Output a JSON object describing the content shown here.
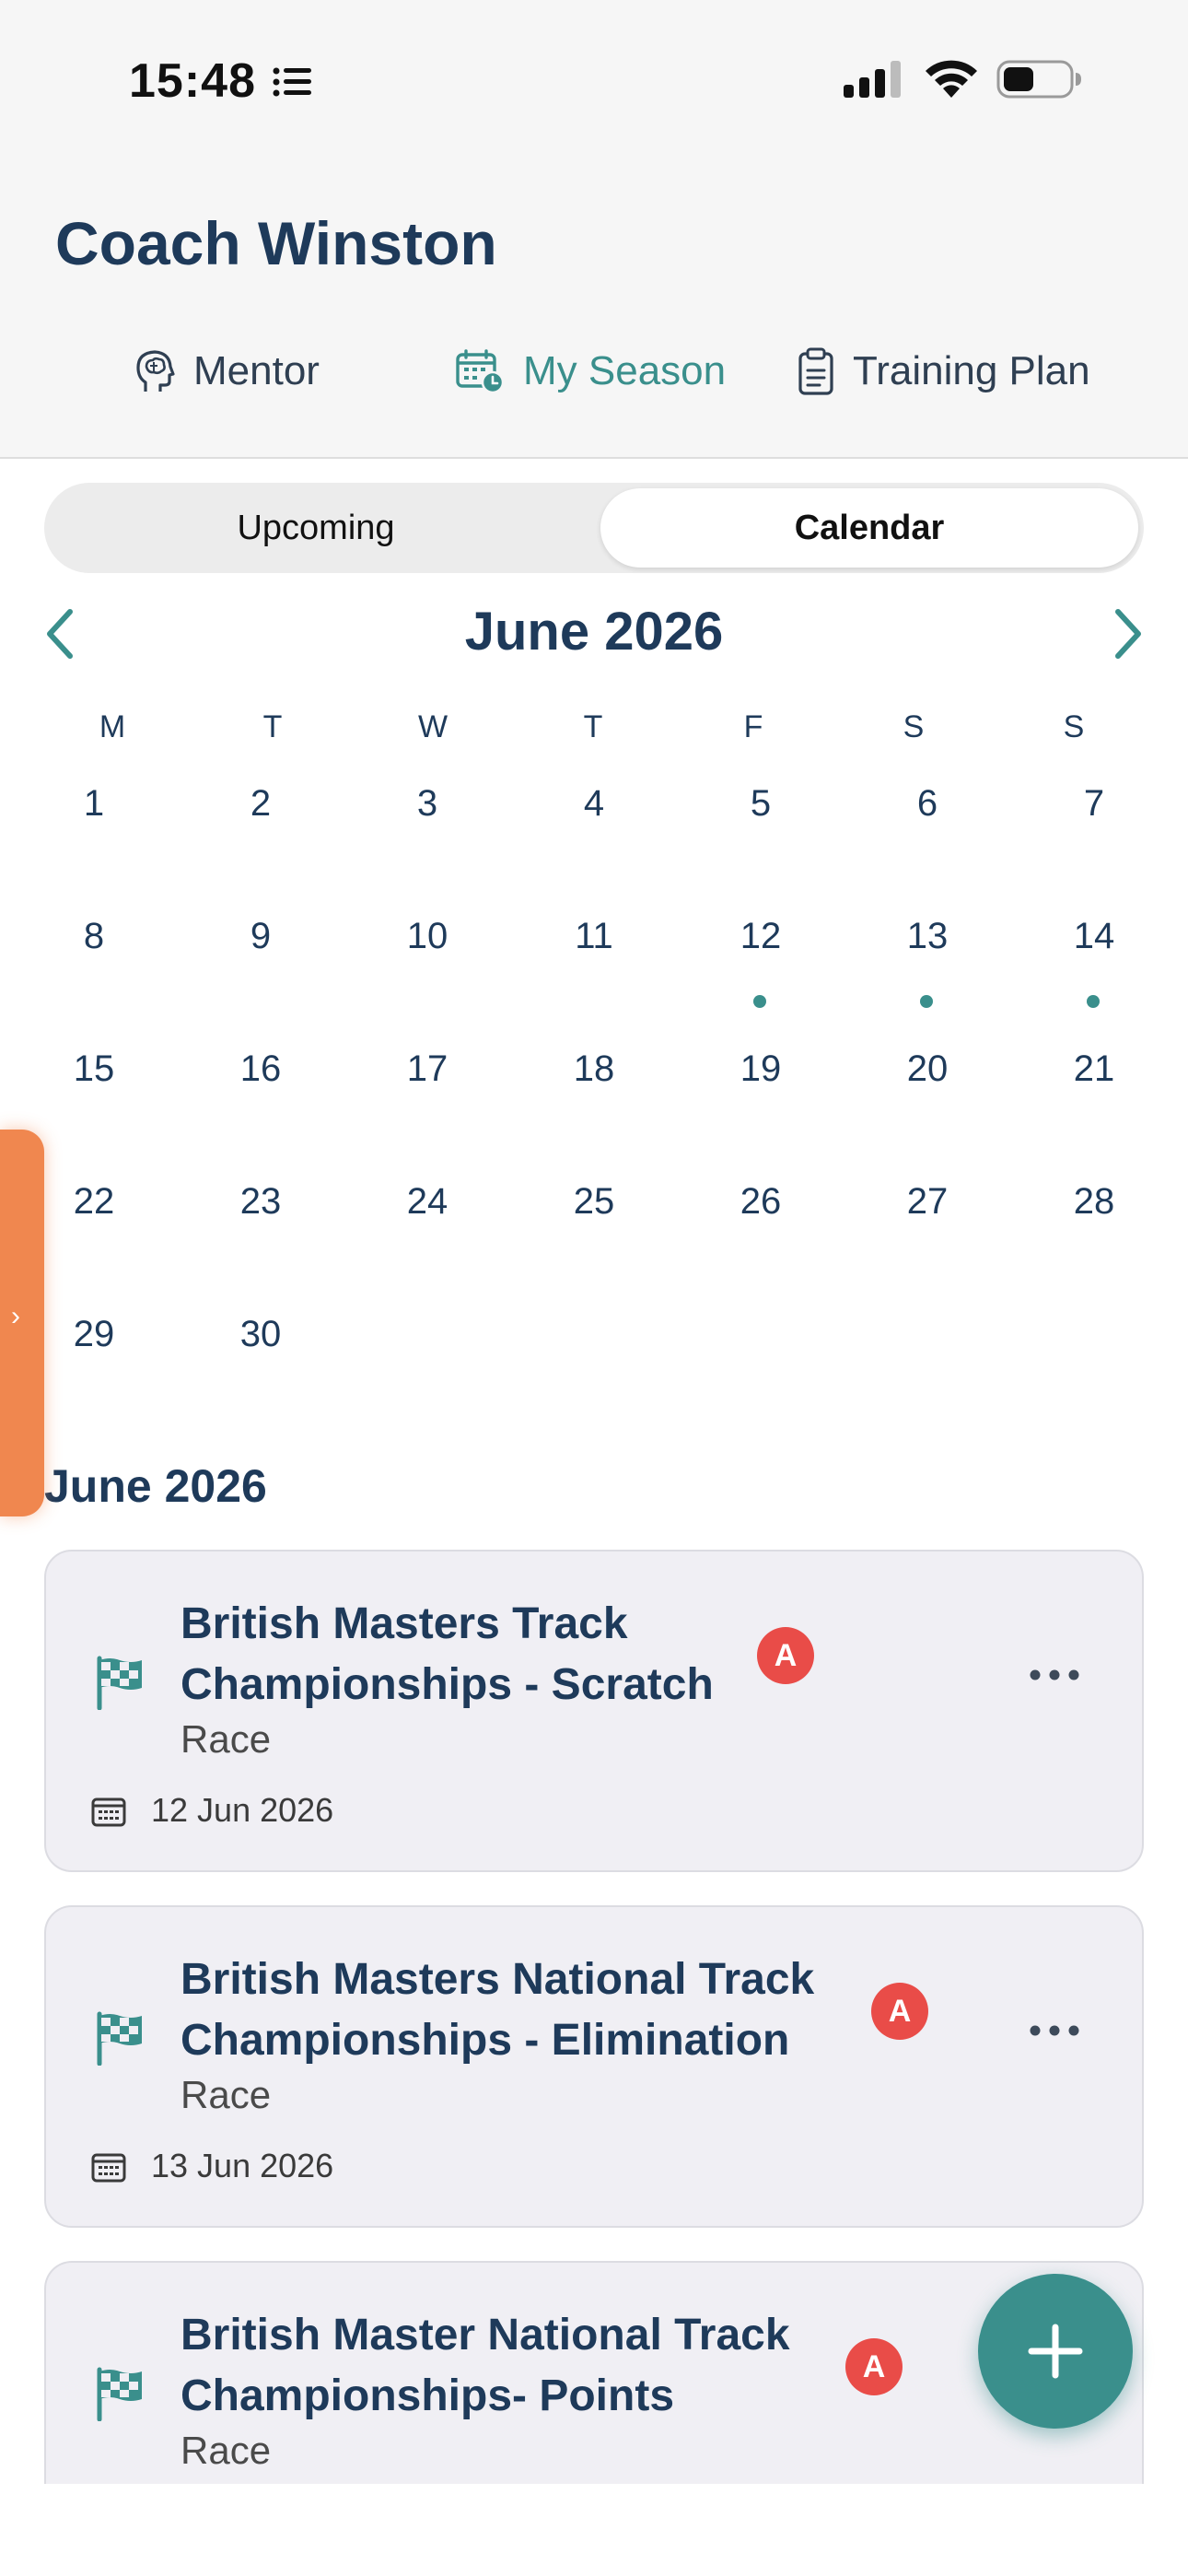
{
  "status_bar": {
    "time": "15:48"
  },
  "header": {
    "title": "Coach Winston"
  },
  "nav_tabs": [
    {
      "label": "Mentor",
      "icon": "brain-head-icon",
      "active": false
    },
    {
      "label": "My Season",
      "icon": "calendar-clock-icon",
      "active": true
    },
    {
      "label": "Training Plan",
      "icon": "clipboard-icon",
      "active": false
    }
  ],
  "segment": {
    "options": [
      "Upcoming",
      "Calendar"
    ],
    "selected": "Calendar"
  },
  "calendar": {
    "month_label": "June 2026",
    "weekdays": [
      "M",
      "T",
      "W",
      "T",
      "F",
      "S",
      "S"
    ],
    "days": [
      "1",
      "2",
      "3",
      "4",
      "5",
      "6",
      "7",
      "8",
      "9",
      "10",
      "11",
      "12",
      "13",
      "14",
      "15",
      "16",
      "17",
      "18",
      "19",
      "20",
      "21",
      "22",
      "23",
      "24",
      "25",
      "26",
      "27",
      "28",
      "29",
      "30"
    ],
    "days_with_events": [
      "12",
      "13",
      "14"
    ]
  },
  "events_section": {
    "month_label": "June 2026",
    "events": [
      {
        "title_line1": "British Masters Track",
        "title_line2": "Championships - Scratch",
        "priority": "A",
        "type": "Race",
        "date": "12 Jun 2026"
      },
      {
        "title_line1": "British Masters National Track",
        "title_line2": "Championships - Elimination",
        "priority": "A",
        "type": "Race",
        "date": "13 Jun 2026"
      },
      {
        "title_line1": "British Master National Track",
        "title_line2": "Championships- Points",
        "priority": "A",
        "type": "Race"
      }
    ]
  },
  "colors": {
    "accent": "#3a8f8c",
    "title": "#1e3a5a",
    "badge": "#e94c48",
    "side_handle": "#f0874f"
  }
}
